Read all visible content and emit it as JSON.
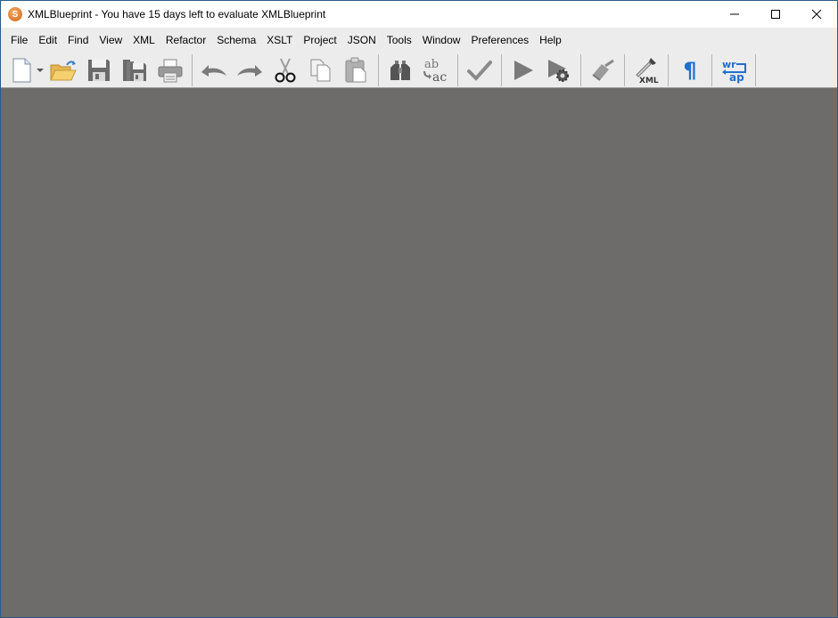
{
  "window": {
    "title": "XMLBlueprint - You have 15 days left to evaluate XMLBlueprint",
    "controls": {
      "minimize": "minimize",
      "maximize": "maximize",
      "close": "close"
    }
  },
  "menubar": {
    "items": [
      "File",
      "Edit",
      "Find",
      "View",
      "XML",
      "Refactor",
      "Schema",
      "XSLT",
      "Project",
      "JSON",
      "Tools",
      "Window",
      "Preferences",
      "Help"
    ]
  },
  "toolbar": {
    "buttons": [
      {
        "name": "new-document",
        "icon": "new-document-icon"
      },
      {
        "name": "new-dropdown",
        "icon": "chevron-down-icon"
      },
      {
        "name": "open",
        "icon": "open-folder-icon"
      },
      {
        "name": "save",
        "icon": "save-icon"
      },
      {
        "name": "save-all",
        "icon": "save-all-icon"
      },
      {
        "name": "print",
        "icon": "printer-icon"
      },
      {
        "name": "undo",
        "icon": "undo-icon"
      },
      {
        "name": "redo",
        "icon": "redo-icon"
      },
      {
        "name": "cut",
        "icon": "scissors-icon"
      },
      {
        "name": "copy",
        "icon": "copy-icon"
      },
      {
        "name": "paste",
        "icon": "paste-icon"
      },
      {
        "name": "find",
        "icon": "binoculars-icon"
      },
      {
        "name": "replace",
        "icon": "replace-icon"
      },
      {
        "name": "validate",
        "icon": "checkmark-icon"
      },
      {
        "name": "run",
        "icon": "play-icon"
      },
      {
        "name": "run-settings",
        "icon": "play-gear-icon"
      },
      {
        "name": "clean",
        "icon": "broom-icon"
      },
      {
        "name": "xml-picker",
        "icon": "dropper-xml-icon"
      },
      {
        "name": "show-whitespace",
        "icon": "pilcrow-icon"
      },
      {
        "name": "word-wrap",
        "icon": "word-wrap-icon"
      }
    ],
    "labels": {
      "replace_top": "ab",
      "replace_bottom": "ac",
      "xml": "XML",
      "pilcrow": "¶",
      "wrap_top": "wr",
      "wrap_bottom": "ap"
    }
  },
  "colors": {
    "workspace": "#6d6c6a",
    "toolbar": "#ececec",
    "accent_blue": "#1f6fcf",
    "app_icon": "#e07b2a"
  }
}
